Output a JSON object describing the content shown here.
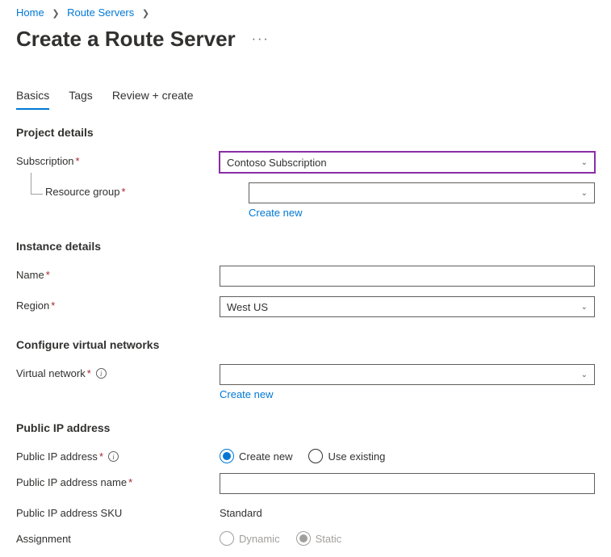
{
  "breadcrumb": {
    "home": "Home",
    "route_servers": "Route Servers"
  },
  "pageTitle": "Create a Route Server",
  "tabs": {
    "basics": "Basics",
    "tags": "Tags",
    "review": "Review + create"
  },
  "sections": {
    "project_details": "Project details",
    "instance_details": "Instance details",
    "configure_vnet": "Configure virtual networks",
    "public_ip": "Public IP address"
  },
  "labels": {
    "subscription": "Subscription",
    "resource_group": "Resource group",
    "name": "Name",
    "region": "Region",
    "virtual_network": "Virtual network",
    "public_ip_address": "Public IP address",
    "public_ip_name": "Public IP address name",
    "public_ip_sku": "Public IP address SKU",
    "assignment": "Assignment"
  },
  "values": {
    "subscription": "Contoso Subscription",
    "resource_group": "",
    "name": "",
    "region": "West US",
    "virtual_network": "",
    "public_ip_name": "",
    "public_ip_sku": "Standard"
  },
  "links": {
    "create_new": "Create new"
  },
  "radios": {
    "create_new": "Create new",
    "use_existing": "Use existing",
    "dynamic": "Dynamic",
    "static": "Static"
  }
}
